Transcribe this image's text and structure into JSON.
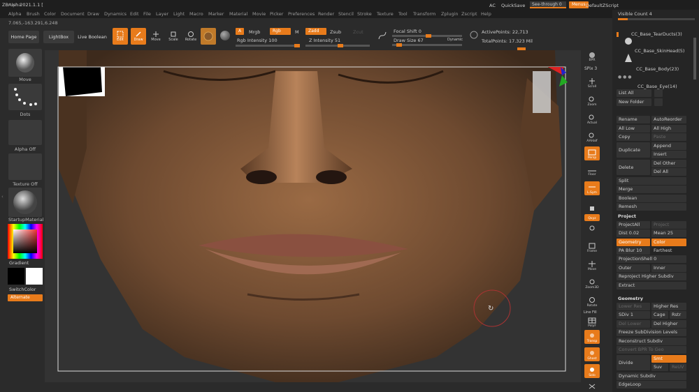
{
  "app": {
    "title": "ZBrush 2021.1.1 [",
    "coords": "7.065,-163.291,6.248"
  },
  "menus": [
    "Alpha",
    "Brush",
    "Color",
    "Document",
    "Draw",
    "Dynamics",
    "Edit",
    "File",
    "Layer",
    "Light",
    "Macro",
    "Marker",
    "Material",
    "Movie",
    "Picker",
    "Preferences",
    "Render",
    "Stencil",
    "Stroke",
    "Texture",
    "Tool",
    "Transform",
    "Zplugin",
    "Zscript",
    "Help"
  ],
  "topright": {
    "ac": "AC",
    "quicksave": "QuickSave",
    "seethrough": "See-through  0",
    "menus": "Menus",
    "script": "DefaultZScript"
  },
  "toolbar": {
    "home": "Home Page",
    "lightbox": "LightBox",
    "liveboolean": "Live Boolean",
    "edit": "Edit",
    "draw": "Draw",
    "move": "Move",
    "scale": "Scale",
    "rotate": "Rotate",
    "a": "A",
    "mrgb": "Mrgb",
    "rgb": "Rgb",
    "m": "M",
    "zadd": "Zadd",
    "zsub": "Zsub",
    "zcut": "Zcut",
    "rgb_intensity": "Rgb Intensity 100",
    "z_intensity": "Z Intensity 51",
    "focal_shift": "Focal Shift 0",
    "draw_size": "Draw Size 67",
    "dynamic": "Dynamic",
    "active_points": "ActivePoints: 22,713",
    "total_points": "TotalPoints: 17.323 Mil"
  },
  "left": {
    "move": "Move",
    "dots": "Dots",
    "alpha": "Alpha Off",
    "texture": "Texture Off",
    "material": "StartupMaterial",
    "gradient": "Gradient",
    "switchcolor": "SwitchColor",
    "alternate": "Alternate"
  },
  "right": {
    "spix": "SPix 3",
    "bpr": "BPR",
    "scroll": "Scroll",
    "zoom": "Zoom",
    "actual": "Actual",
    "aahalf": "AAHalf",
    "persp": "Persp",
    "floor": "Floor",
    "lsym": "L.Sym",
    "xyz": "Qxyz",
    "frame": "Frame",
    "move": "Move",
    "zoom3d": "Zoom3D",
    "rotate": "Rotate",
    "linefill": "Line Fill",
    "polyf": "PolyF",
    "transp": "Transp",
    "ghost": "Ghost",
    "solo": "Solo",
    "xpose": "Xpose"
  },
  "tray": {
    "visible": "Visible Count 4",
    "subtools": [
      "CC_Base_TearDucts(3)",
      "CC_Base_SkinHead(5)",
      "CC_Base_Body(23)",
      "CC_Base_Eye(14)"
    ],
    "listall": "List All",
    "newfolder": "New Folder",
    "rename": "Rename",
    "autoreorder": "AutoReorder",
    "alllow": "All Low",
    "allhigh": "All High",
    "copy": "Copy",
    "paste": "Paste",
    "duplicate": "Duplicate",
    "append": "Append",
    "insert": "Insert",
    "delete": "Delete",
    "delother": "Del Other",
    "delall": "Del All",
    "split": "Split",
    "merge": "Merge",
    "boolean": "Boolean",
    "remesh": "Remesh",
    "project": "Project",
    "projectall": "ProjectAll",
    "projecthistory": "Project History",
    "dist": "Dist 0.02",
    "mean": "Mean 25",
    "geometry": "Geometry",
    "color": "Color",
    "pablur": "PA Blur 10",
    "farthest": "Farthest",
    "projshell": "ProjectionShell 0",
    "outer": "Outer",
    "inner": "Inner",
    "reproject": "Reproject Higher Subdiv",
    "extract": "Extract",
    "geohdr": "Geometry",
    "lowerres": "Lower Res",
    "higherres": "Higher Res",
    "sdiv": "SDiv 1",
    "cage": "Cage",
    "rstr": "Rstr",
    "dellower": "Del Lower",
    "delhigher": "Del Higher",
    "freeze": "Freeze SubDivision Levels",
    "reconstruct": "Reconstruct Subdiv",
    "convertbpr": "Convert BPR To Geo",
    "divide": "Divide",
    "smt": "Smt",
    "suv": "Suv",
    "reluv": "ReUV",
    "dynsub": "Dynamic Subdiv",
    "edgeloop": "EdgeLoop"
  },
  "colors": {
    "accent": "#e87b1b",
    "panel": "#2b2b2b",
    "tray": "#252525"
  }
}
